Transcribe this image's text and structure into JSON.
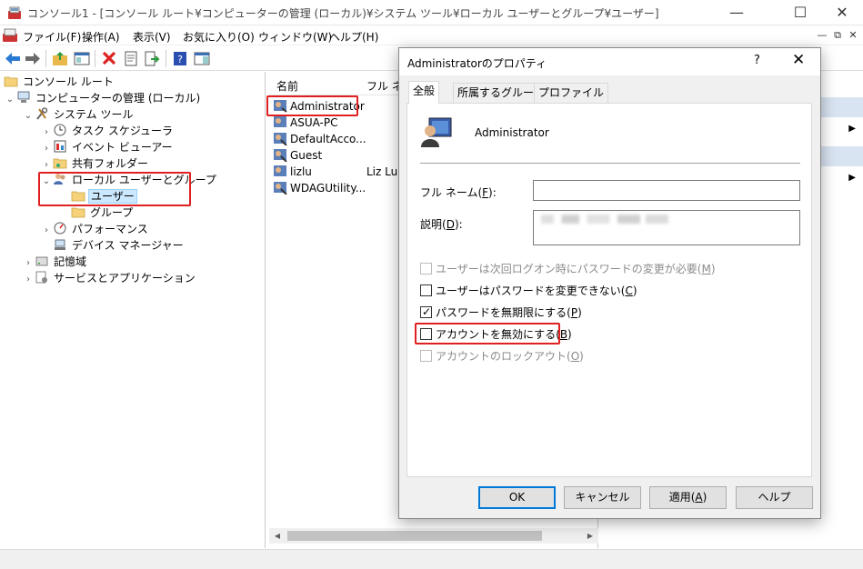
{
  "window": {
    "title": "コンソール1 - [コンソール ルート¥コンピューターの管理 (ローカル)¥システム ツール¥ローカル ユーザーとグループ¥ユーザー]",
    "minimize": "—",
    "maximize": "☐",
    "close": "✕"
  },
  "menubar": {
    "items": [
      "ファイル(F)",
      "操作(A)",
      "表示(V)",
      "お気に入り(O)",
      "ウィンドウ(W)",
      "ヘルプ(H)"
    ],
    "mdi_minimize": "—",
    "mdi_restore": "⧉",
    "mdi_close": "✕"
  },
  "tree": {
    "items": [
      {
        "label": "コンソール ルート",
        "twisty": ""
      },
      {
        "label": "コンピューターの管理 (ローカル)",
        "twisty": "⌄"
      },
      {
        "label": "システム ツール",
        "twisty": "⌄"
      },
      {
        "label": "タスク スケジューラ",
        "twisty": "›"
      },
      {
        "label": "イベント ビューアー",
        "twisty": "›"
      },
      {
        "label": "共有フォルダー",
        "twisty": "›"
      },
      {
        "label": "ローカル ユーザーとグループ",
        "twisty": "⌄"
      },
      {
        "label": "ユーザー",
        "twisty": ""
      },
      {
        "label": "グループ",
        "twisty": ""
      },
      {
        "label": "パフォーマンス",
        "twisty": "›"
      },
      {
        "label": "デバイス マネージャー",
        "twisty": ""
      },
      {
        "label": "記憶域",
        "twisty": "›"
      },
      {
        "label": "サービスとアプリケーション",
        "twisty": "›"
      }
    ]
  },
  "list": {
    "col_name": "名前",
    "col_fullname": "フル ネ",
    "rows": [
      {
        "name": "Administrator",
        "fullname": ""
      },
      {
        "name": "ASUA-PC",
        "fullname": ""
      },
      {
        "name": "DefaultAcco...",
        "fullname": ""
      },
      {
        "name": "Guest",
        "fullname": ""
      },
      {
        "name": "lizlu",
        "fullname": "Liz Lu"
      },
      {
        "name": "WDAGUtility...",
        "fullname": ""
      }
    ],
    "scroll_left": "◀",
    "scroll_right": "▶"
  },
  "actions": {
    "arrow": "▶"
  },
  "dialog": {
    "title": "Administratorのプロパティ",
    "help": "?",
    "close": "✕",
    "tabs": [
      "全般",
      "所属するグループ",
      "プロファイル"
    ],
    "user_name": "Administrator",
    "fullname_label": "フル ネーム(",
    "fullname_key": "F",
    "fullname_suffix": "):",
    "fullname_value": "",
    "desc_label": "説明(",
    "desc_key": "D",
    "desc_suffix": "):",
    "checkboxes": [
      {
        "label": "ユーザーは次回ログオン時にパスワードの変更が必要(",
        "key": "M",
        "suffix": ")",
        "checked": false,
        "disabled": true
      },
      {
        "label": "ユーザーはパスワードを変更できない(",
        "key": "C",
        "suffix": ")",
        "checked": false,
        "disabled": false
      },
      {
        "label": "パスワードを無期限にする(",
        "key": "P",
        "suffix": ")",
        "checked": true,
        "disabled": false
      },
      {
        "label": "アカウントを無効にする(",
        "key": "B",
        "suffix": ")",
        "checked": false,
        "disabled": false
      },
      {
        "label": "アカウントのロックアウト(",
        "key": "O",
        "suffix": ")",
        "checked": false,
        "disabled": true
      }
    ],
    "buttons": {
      "ok": "OK",
      "cancel": "キャンセル",
      "apply_prefix": "適用(",
      "apply_key": "A",
      "apply_suffix": ")",
      "help": "ヘルプ"
    }
  },
  "colors": {
    "highlight": "#e02020",
    "selection": "#cce8ff",
    "action_header": "#d9e4f2",
    "default_button": "#0078d7"
  }
}
